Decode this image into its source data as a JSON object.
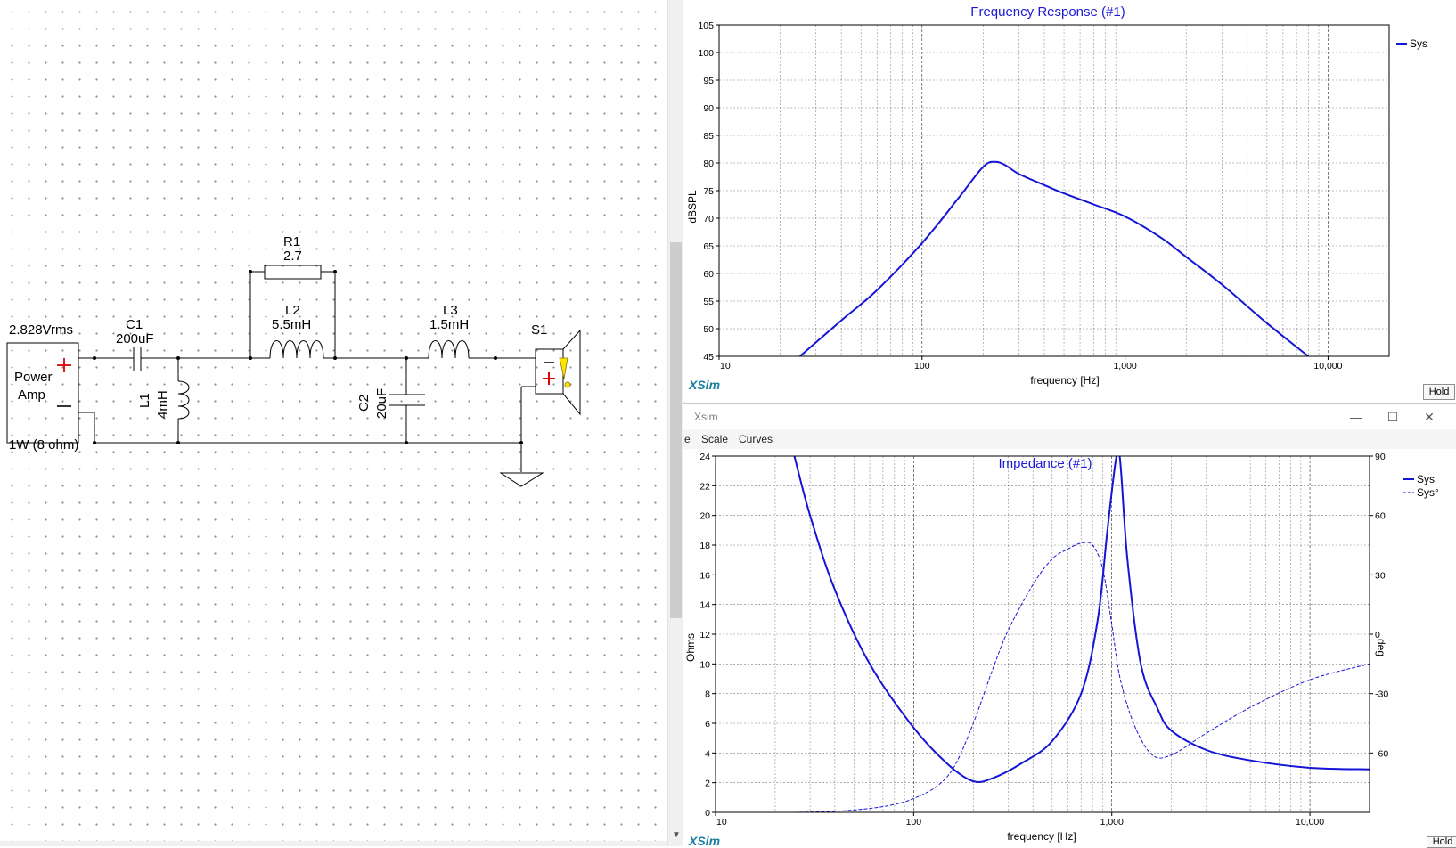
{
  "schematic": {
    "source": {
      "voltage": "2.828Vrms",
      "name_line1": "Power",
      "name_line2": "Amp",
      "power": "1W (8 ohm)",
      "plus": "+",
      "minus": "—"
    },
    "c1": {
      "name": "C1",
      "value": "200uF"
    },
    "l1": {
      "name": "L1",
      "value": "4mH"
    },
    "r1": {
      "name": "R1",
      "value": "2.7"
    },
    "l2": {
      "name": "L2",
      "value": "5.5mH"
    },
    "l3": {
      "name": "L3",
      "value": "1.5mH"
    },
    "c2": {
      "name": "C2",
      "value": "20uF"
    },
    "s1": {
      "name": "S1"
    }
  },
  "freq_window": {
    "brand": "XSim",
    "hold_label": "Hold",
    "chart": {
      "type": "line",
      "title": "Frequency Response (#1)",
      "xlabel": "frequency [Hz]",
      "ylabel": "dBSPL",
      "x_scale": "log",
      "xlim": [
        10,
        20000
      ],
      "ylim": [
        45,
        105
      ],
      "grid": true,
      "legend_position": "right",
      "xticks": [
        {
          "value": 10,
          "label": "10"
        },
        {
          "value": 100,
          "label": "100"
        },
        {
          "value": 1000,
          "label": "1,000"
        },
        {
          "value": 10000,
          "label": "10,000"
        }
      ],
      "yticks": [
        45,
        50,
        55,
        60,
        65,
        70,
        75,
        80,
        85,
        90,
        95,
        100,
        105
      ],
      "series": [
        {
          "name": "Sys",
          "color": "#1515d6",
          "x": [
            25,
            40,
            60,
            100,
            150,
            200,
            230,
            260,
            300,
            400,
            500,
            700,
            1000,
            1500,
            2000,
            3000,
            5000,
            8000
          ],
          "y": [
            45,
            51.5,
            57,
            65.5,
            73.5,
            79.3,
            80.2,
            79.5,
            78,
            76,
            74.5,
            72.5,
            70.3,
            66.5,
            63,
            58,
            51,
            45
          ]
        }
      ]
    }
  },
  "imp_window": {
    "window_title": "Xsim",
    "brand": "XSim",
    "hold_label": "Hold",
    "controls": {
      "minimize": "—",
      "maximize": "☐",
      "close": "✕"
    },
    "menu": {
      "file_partial": "e",
      "scale": "Scale",
      "curves": "Curves"
    },
    "chart": {
      "type": "line",
      "title": "Impedance (#1)",
      "xlabel": "frequency [Hz]",
      "ylabel": "Ohms",
      "y2label": "deg",
      "x_scale": "log",
      "xlim": [
        10,
        20000
      ],
      "ylim": [
        0,
        24
      ],
      "y2lim": [
        -90,
        90
      ],
      "grid": true,
      "legend_position": "right",
      "xticks": [
        {
          "value": 10,
          "label": "10"
        },
        {
          "value": 100,
          "label": "100"
        },
        {
          "value": 1000,
          "label": "1,000"
        },
        {
          "value": 10000,
          "label": "10,000"
        }
      ],
      "yticks": [
        0,
        2,
        4,
        6,
        8,
        10,
        12,
        14,
        16,
        18,
        20,
        22,
        24
      ],
      "y2ticks": [
        90,
        60,
        30,
        0,
        -30,
        -60
      ],
      "series": [
        {
          "name": "Sys",
          "axis": "left",
          "style": "solid",
          "color": "#1515d6",
          "x": [
            25,
            30,
            40,
            60,
            100,
            150,
            200,
            250,
            350,
            500,
            700,
            850,
            950,
            1050,
            1100,
            1200,
            1400,
            1700,
            2000,
            3000,
            5000,
            10000,
            20000
          ],
          "y": [
            24,
            20,
            15,
            10,
            5.7,
            3.2,
            2.1,
            2.3,
            3.3,
            4.8,
            8,
            13,
            19,
            23.8,
            23.8,
            17,
            10,
            7,
            5.5,
            4.2,
            3.5,
            3.0,
            2.9
          ]
        },
        {
          "name": "Sys°",
          "axis": "right",
          "style": "dashed",
          "color": "#1515d6",
          "x": [
            25,
            40,
            60,
            80,
            100,
            130,
            160,
            200,
            250,
            300,
            400,
            500,
            600,
            700,
            800,
            900,
            1000,
            1100,
            1300,
            1600,
            2000,
            3000,
            5000,
            10000,
            20000
          ],
          "y": [
            -90,
            -89.5,
            -88,
            -86,
            -83,
            -77,
            -67,
            -45,
            -18,
            2,
            25,
            38,
            43,
            46,
            45,
            33,
            5,
            -22,
            -46,
            -61,
            -61,
            -50,
            -37,
            -23,
            -15
          ]
        }
      ]
    }
  }
}
